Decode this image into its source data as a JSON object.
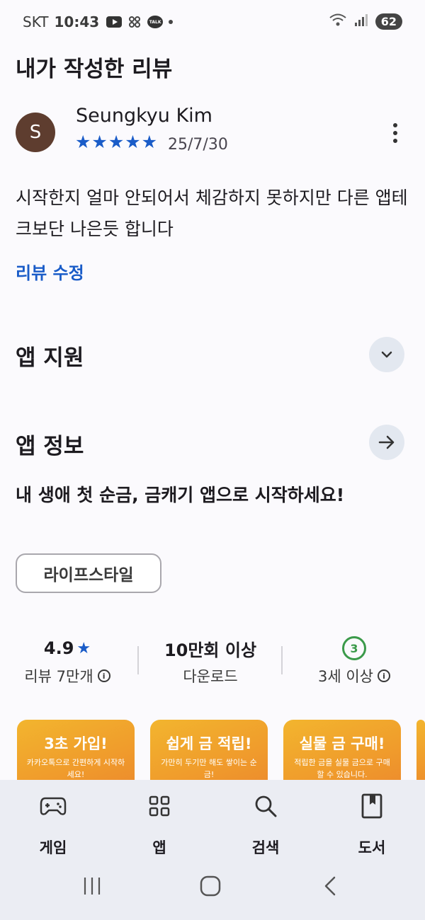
{
  "status_bar": {
    "carrier": "SKT",
    "time": "10:43",
    "talk_badge": "TALK",
    "battery": "62",
    "icons": [
      "youtube-icon",
      "app-icon",
      "kakaotalk-icon",
      "notification-dot-icon",
      "wifi-icon",
      "signal-icon",
      "battery-icon"
    ]
  },
  "page_title": "내가 작성한 리뷰",
  "review": {
    "avatar_initial": "S",
    "reviewer": "Seungkyu Kim",
    "stars": "★★★★★",
    "rating": 5,
    "date": "25/7/30",
    "text": "시작한지 얼마 안되어서 체감하지 못하지만 다른 앱테크보단 나은듯 합니다",
    "edit_label": "리뷰 수정"
  },
  "sections": {
    "app_support": "앱 지원",
    "app_info": "앱 정보"
  },
  "app_description": "내 생애 첫 순금, 금캐기 앱으로 시작하세요!",
  "category": "라이프스타일",
  "stats": {
    "rating_value": "4.9",
    "rating_star": "★",
    "reviews_label": "리뷰 7만개",
    "downloads_value": "10만회 이상",
    "downloads_label": "다운로드",
    "age_value": "3",
    "age_label": "3세 이상"
  },
  "screenshots": [
    {
      "title": "3초 가입!",
      "subtitle": "카카오톡으로 간편하게 시작하세요!"
    },
    {
      "title": "쉽게 금 적립!",
      "subtitle": "가만히 두기만 해도 쌓이는 순금!"
    },
    {
      "title": "실물 금 구매!",
      "subtitle": "적립한 금을 실물 금으로 구매 할 수 있습니다."
    }
  ],
  "bottom_nav": [
    {
      "label": "게임",
      "icon": "gamepad-icon"
    },
    {
      "label": "앱",
      "icon": "apps-grid-icon"
    },
    {
      "label": "검색",
      "icon": "search-icon"
    },
    {
      "label": "도서",
      "icon": "book-icon"
    }
  ],
  "colors": {
    "accent": "#1a5cc8",
    "avatar_bg": "#5e3d2f",
    "age_badge": "#3b9a4a",
    "chip_button_bg": "#e3e8f0",
    "nav_bg": "#ebedf3"
  }
}
